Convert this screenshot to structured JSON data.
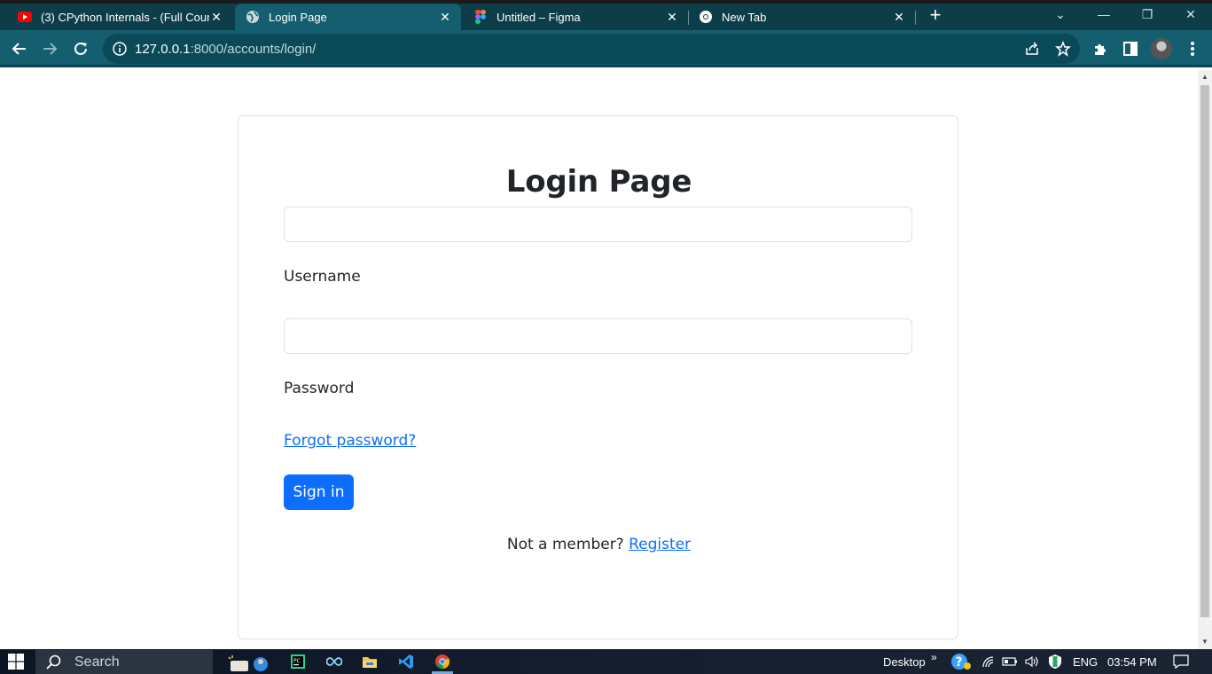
{
  "browser": {
    "tabs": [
      {
        "title": "(3) CPython Internals - (Full Cour",
        "icon": "youtube-icon",
        "active": false
      },
      {
        "title": "Login Page",
        "icon": "globe-icon",
        "active": true
      },
      {
        "title": "Untitled – Figma",
        "icon": "figma-icon",
        "active": false
      },
      {
        "title": "New Tab",
        "icon": "chrome-icon",
        "active": false
      }
    ],
    "url_host": "127.0.0.1",
    "url_path": ":8000/accounts/login/"
  },
  "page": {
    "title": "Login Page",
    "username_label": "Username",
    "username_value": "",
    "password_label": "Password",
    "password_value": "",
    "forgot_link": "Forgot password?",
    "signin_label": "Sign in",
    "not_member_text": "Not a member?",
    "register_link": "Register"
  },
  "taskbar": {
    "search_placeholder": "Search",
    "desktop_label": "Desktop",
    "language": "ENG",
    "time": "03:54 PM"
  },
  "colors": {
    "primary": "#0d6efd",
    "tab_strip": "#0c3d48",
    "toolbar": "#145e70"
  }
}
